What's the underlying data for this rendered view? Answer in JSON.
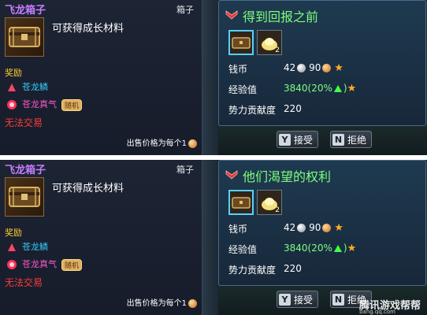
{
  "screens": [
    {
      "tooltip": {
        "item_name": "飞龙箱子",
        "item_type": "箱子",
        "description": "可获得成长材料",
        "reward_heading": "奖励",
        "reward1": "苍龙鳞",
        "reward2": "苍龙真气",
        "reward2_badge": "随机",
        "untradeable": "无法交易",
        "sell_price": "出售价格为每个1"
      },
      "quest": {
        "title": "得到回报之前",
        "slot2_count": "2",
        "money_label": "钱币",
        "money_silver": "42",
        "money_copper": "90",
        "exp_label": "经验值",
        "exp_value": "3840(20%",
        "exp_close": ")",
        "contrib_label": "势力贡献度",
        "contrib_value": "220",
        "accept_key": "Y",
        "accept_label": "接受",
        "reject_key": "N",
        "reject_label": "拒绝"
      }
    },
    {
      "tooltip": {
        "item_name": "飞龙箱子",
        "item_type": "箱子",
        "description": "可获得成长材料",
        "reward_heading": "奖励",
        "reward1": "苍龙鳞",
        "reward2": "苍龙真气",
        "reward2_badge": "随机",
        "untradeable": "无法交易",
        "sell_price": "出售价格为每个1"
      },
      "quest": {
        "title": "他们渴望的权利",
        "slot2_count": "2",
        "money_label": "钱币",
        "money_silver": "42",
        "money_copper": "90",
        "exp_label": "经验值",
        "exp_value": "3840(20%",
        "exp_close": ")",
        "contrib_label": "势力贡献度",
        "contrib_value": "220",
        "accept_key": "Y",
        "accept_label": "接受",
        "reject_key": "N",
        "reject_label": "拒绝"
      }
    }
  ],
  "watermark": {
    "brand": "腾讯游戏帮帮",
    "site": "bang.qq.com"
  },
  "colors": {
    "item_name": "#c77dff",
    "quest_title": "#7dff7d",
    "untradeable": "#ff3b3b",
    "reward_heading": "#ffcc33"
  },
  "icons": {
    "chest": "chest-icon",
    "scale": "dragon-scale-icon",
    "essence": "dragon-essence-icon",
    "silver": "silver-coin-icon",
    "copper": "copper-coin-icon",
    "star": "star-icon",
    "arrow": "arrow-up-icon",
    "emblem": "quest-emblem-icon"
  }
}
